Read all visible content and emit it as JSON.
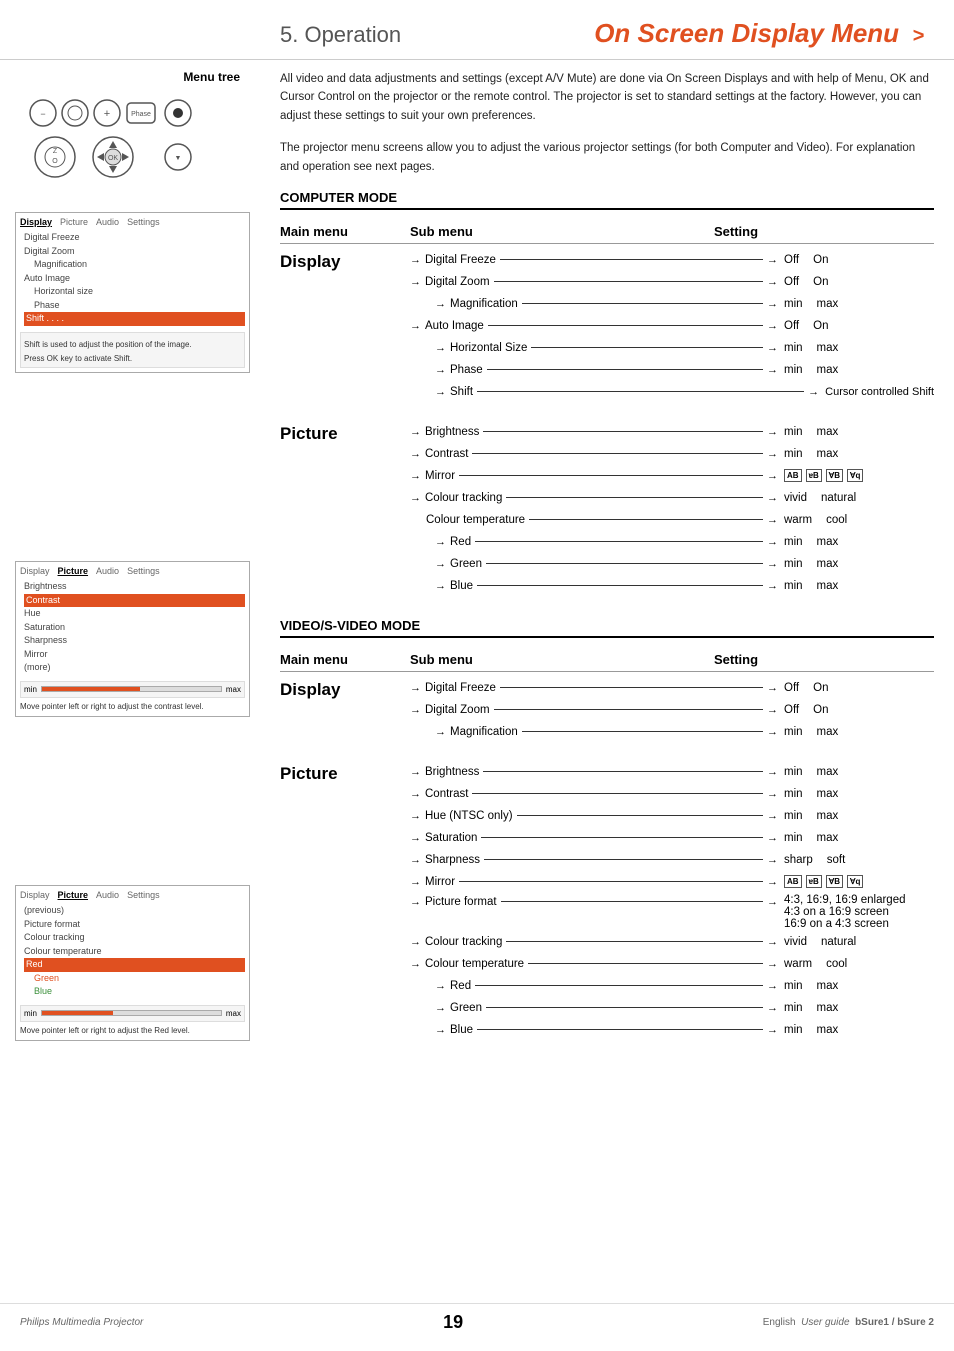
{
  "header": {
    "section": "5. Operation",
    "title": "On Screen Display Menu",
    "arrow": ">"
  },
  "sidebar": {
    "menuTreeLabel": "Menu tree",
    "osd1": {
      "tabs": [
        "Display",
        "Picture",
        "Audio",
        "Settings"
      ],
      "items": [
        "Digital Freeze",
        "Digital Zoom",
        "Magnification",
        "Auto Image",
        "Horizontal size",
        "Phase",
        "Shift . . . .",
        ""
      ],
      "helpText1": "Shift is used to adjust the position of the image.",
      "helpText2": "Press OK key to activate Shift."
    },
    "osd2": {
      "tabs": [
        "Display",
        "Picture",
        "Audio",
        "Settings"
      ],
      "items": [
        "Brightness",
        "Contrast",
        "Hue",
        "Saturation",
        "Sharpness",
        "Mirror",
        "(more)"
      ],
      "sliderMin": "min",
      "sliderMax": "max",
      "helpText": "Move pointer left or right to adjust the contrast level."
    },
    "osd3": {
      "tabs": [
        "Display",
        "Picture",
        "Audio",
        "Settings"
      ],
      "items": [
        "(previous)",
        "Picture format",
        "Colour tracking",
        "Colour temperature",
        "Red",
        "Green",
        "Blue",
        ""
      ],
      "sliderMin": "min",
      "sliderMax": "max",
      "helpText": "Move pointer left or right to adjust the Red level."
    }
  },
  "main": {
    "introText": "All video and data adjustments and settings (except A/V Mute) are done via On Screen Displays and with help of Menu, OK and Cursor Control on the projector or the remote control. The projector is set to standard settings at the factory. However, you can adjust these settings to suit your own preferences.",
    "introText2": "The projector menu screens allow you to adjust the various projector settings (for both Computer and Video). For explanation and operation see next pages.",
    "tableHeaders": {
      "mainMenu": "Main menu",
      "subMenu": "Sub menu",
      "setting": "Setting"
    },
    "computerMode": {
      "title": "COMPUTER MODE",
      "display": {
        "label": "Display",
        "items": [
          {
            "label": "Digital Freeze",
            "setting1": "Off",
            "setting2": "On"
          },
          {
            "label": "Digital Zoom",
            "setting1": "Off",
            "setting2": "On"
          },
          {
            "label": "Magnification",
            "setting1": "min",
            "setting2": "max"
          },
          {
            "label": "Auto Image",
            "setting1": "Off",
            "setting2": "On"
          },
          {
            "label": "Horizontal Size",
            "setting1": "min",
            "setting2": "max"
          },
          {
            "label": "Phase",
            "setting1": "min",
            "setting2": "max"
          },
          {
            "label": "Shift",
            "setting1": "Cursor controlled Shift"
          }
        ]
      },
      "picture": {
        "label": "Picture",
        "items": [
          {
            "label": "Brightness",
            "setting1": "min",
            "setting2": "max"
          },
          {
            "label": "Contrast",
            "setting1": "min",
            "setting2": "max"
          },
          {
            "label": "Mirror",
            "icon1": "AB",
            "icon2": "ɐB",
            "icon3": "∀B",
            "icon4": "∀q"
          },
          {
            "label": "Colour tracking",
            "setting1": "vivid",
            "setting2": "natural"
          },
          {
            "label": "Colour temperature",
            "setting1": "warm",
            "setting2": "cool"
          },
          {
            "label": "Red",
            "setting1": "min",
            "setting2": "max"
          },
          {
            "label": "Green",
            "setting1": "min",
            "setting2": "max"
          },
          {
            "label": "Blue",
            "setting1": "min",
            "setting2": "max"
          }
        ]
      }
    },
    "videoMode": {
      "title": "VIDEO/S-VIDEO MODE",
      "display": {
        "label": "Display",
        "items": [
          {
            "label": "Digital Freeze",
            "setting1": "Off",
            "setting2": "On"
          },
          {
            "label": "Digital Zoom",
            "setting1": "Off",
            "setting2": "On"
          },
          {
            "label": "Magnification",
            "setting1": "min",
            "setting2": "max"
          }
        ]
      },
      "picture": {
        "label": "Picture",
        "items": [
          {
            "label": "Brightness",
            "setting1": "min",
            "setting2": "max"
          },
          {
            "label": "Contrast",
            "setting1": "min",
            "setting2": "max"
          },
          {
            "label": "Hue (NTSC only)",
            "setting1": "min",
            "setting2": "max"
          },
          {
            "label": "Saturation",
            "setting1": "min",
            "setting2": "max"
          },
          {
            "label": "Sharpness",
            "setting1": "sharp",
            "setting2": "soft"
          },
          {
            "label": "Mirror",
            "icon1": "AB",
            "icon2": "ɐB",
            "icon3": "∀B",
            "icon4": "∀q"
          },
          {
            "label": "Picture format",
            "ratio1": "4:3, 16:9, 16:9 enlarged",
            "ratio2": "4:3 on a 16:9 screen",
            "ratio3": "16:9 on a 4:3 screen"
          },
          {
            "label": "Colour tracking",
            "setting1": "vivid",
            "setting2": "natural"
          },
          {
            "label": "Colour temperature",
            "setting1": "warm",
            "setting2": "cool"
          },
          {
            "label": "Red",
            "setting1": "min",
            "setting2": "max"
          },
          {
            "label": "Green",
            "setting1": "min",
            "setting2": "max"
          },
          {
            "label": "Blue",
            "setting1": "min",
            "setting2": "max"
          }
        ]
      }
    }
  },
  "footer": {
    "brand": "Philips Multimedia Projector",
    "pageNumber": "19",
    "language": "English",
    "userguide": "User guide",
    "product": "bSure1 / bSure 2"
  }
}
